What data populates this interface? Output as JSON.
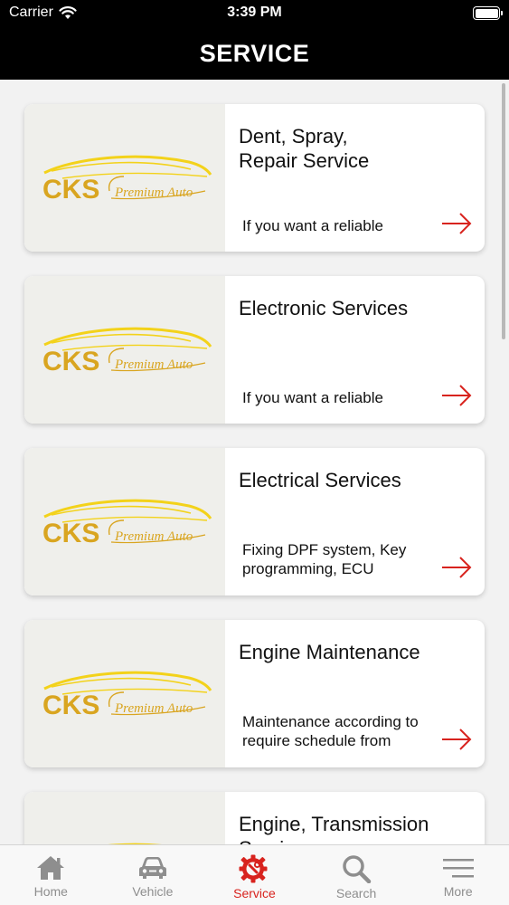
{
  "status_bar": {
    "carrier": "Carrier",
    "time": "3:39 PM"
  },
  "header": {
    "title": "SERVICE"
  },
  "logo": {
    "brand": "CKS",
    "tagline": "Premium Auto"
  },
  "cards": [
    {
      "title": "Dent, Spray,\nRepair Service",
      "description": "If you want a  reliable"
    },
    {
      "title": "Electronic Services",
      "description": "If you want a  reliable"
    },
    {
      "title": "Electrical Services",
      "description": "Fixing DPF system, Key programming, ECU"
    },
    {
      "title": "Engine Maintenance",
      "description": "Maintenance according to require schedule from"
    },
    {
      "title": "Engine, Transmission Services",
      "description": ""
    }
  ],
  "tabs": [
    {
      "label": "Home",
      "icon": "home-icon"
    },
    {
      "label": "Vehicle",
      "icon": "car-icon"
    },
    {
      "label": "Service",
      "icon": "service-gear-icon"
    },
    {
      "label": "Search",
      "icon": "search-icon"
    },
    {
      "label": "More",
      "icon": "menu-icon"
    }
  ],
  "colors": {
    "accent": "#d8231e",
    "logo_gold": "#d9a520",
    "logo_swoosh": "#f3d21a",
    "bar_bg": "#000000"
  }
}
